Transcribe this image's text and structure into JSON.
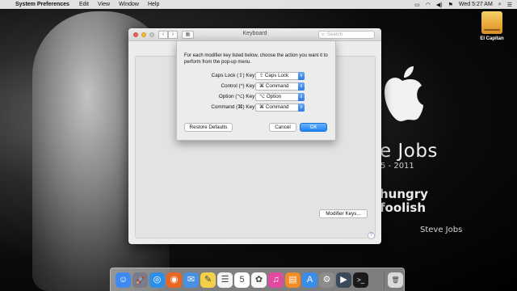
{
  "menubar": {
    "apple_icon": "apple-icon",
    "app_name": "System Preferences",
    "items": [
      "Edit",
      "View",
      "Window",
      "Help"
    ],
    "clock": "Wed 5:27 AM",
    "status_icons": [
      "display-icon",
      "wifi-icon",
      "volume-icon",
      "flag-icon",
      "spotlight-icon",
      "notification-center-icon"
    ]
  },
  "desktop": {
    "disk_label": "El Capitan"
  },
  "wallpaper": {
    "name_text": "e Jobs",
    "years_text": "5 - 2011",
    "quote_line1": "hungry",
    "quote_line2": "foolish",
    "signature": "Steve Jobs"
  },
  "window": {
    "title": "Keyboard",
    "search_placeholder": "Search",
    "modifier_keys_button": "Modifier Keys...",
    "help_button": "?"
  },
  "sheet": {
    "description": "For each modifier key listed below, choose the action you want it to perform from the pop-up menu.",
    "rows": [
      {
        "label": "Caps Lock (⇪) Key:",
        "value": "⇪ Caps Lock"
      },
      {
        "label": "Control (^) Key:",
        "value": "⌘ Command"
      },
      {
        "label": "Option (⌥) Key:",
        "value": "⌥ Option"
      },
      {
        "label": "Command (⌘) Key:",
        "value": "⌘ Command"
      }
    ],
    "restore_defaults": "Restore Defaults",
    "cancel": "Cancel",
    "ok": "OK"
  },
  "dock": {
    "items": [
      {
        "name": "finder-icon",
        "color": "#3d8bf2",
        "glyph": "☺"
      },
      {
        "name": "launchpad-icon",
        "color": "#7b7b8a",
        "glyph": "🚀"
      },
      {
        "name": "safari-icon",
        "color": "#2f8fe6",
        "glyph": "◎"
      },
      {
        "name": "firefox-icon",
        "color": "#e8661f",
        "glyph": "◉"
      },
      {
        "name": "mail-icon",
        "color": "#4a90e2",
        "glyph": "✉"
      },
      {
        "name": "notes-icon",
        "color": "#f2d04a",
        "glyph": "✎"
      },
      {
        "name": "reminders-icon",
        "color": "#f4f4f4",
        "glyph": "☰"
      },
      {
        "name": "calendar-icon",
        "color": "#ffffff",
        "glyph": "5"
      },
      {
        "name": "photos-icon",
        "color": "#f7f7f7",
        "glyph": "✿"
      },
      {
        "name": "itunes-icon",
        "color": "#e04aa0",
        "glyph": "♫"
      },
      {
        "name": "ibooks-icon",
        "color": "#f28a25",
        "glyph": "▤"
      },
      {
        "name": "app-store-icon",
        "color": "#3a8ee8",
        "glyph": "A"
      },
      {
        "name": "system-preferences-icon",
        "color": "#8c8c8c",
        "glyph": "⚙"
      },
      {
        "name": "quicktime-icon",
        "color": "#3b4a5a",
        "glyph": "▶"
      },
      {
        "name": "terminal-icon",
        "color": "#1a1a1a",
        "glyph": ">_"
      },
      {
        "name": "trash-icon",
        "color": "#d9d9d9",
        "glyph": "🗑"
      }
    ]
  }
}
